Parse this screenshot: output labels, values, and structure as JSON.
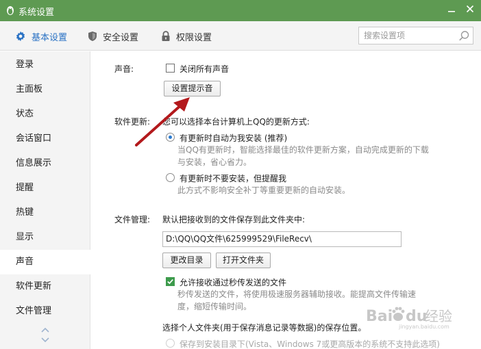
{
  "window": {
    "title": "系统设置"
  },
  "top_tabs": [
    {
      "label": "基本设置",
      "icon": "gear-icon"
    },
    {
      "label": "安全设置",
      "icon": "shield-icon"
    },
    {
      "label": "权限设置",
      "icon": "lock-icon"
    }
  ],
  "search": {
    "placeholder": "搜索设置项"
  },
  "sidebar": {
    "items": [
      {
        "label": "登录"
      },
      {
        "label": "主面板"
      },
      {
        "label": "状态"
      },
      {
        "label": "会话窗口"
      },
      {
        "label": "信息展示"
      },
      {
        "label": "提醒"
      },
      {
        "label": "热键"
      },
      {
        "label": "显示"
      },
      {
        "label": "声音"
      },
      {
        "label": "软件更新"
      },
      {
        "label": "文件管理"
      }
    ],
    "active": "声音"
  },
  "sound": {
    "label": "声音:",
    "mute_all": "关闭所有声音",
    "set_tone_button": "设置提示音"
  },
  "update": {
    "label": "软件更新:",
    "intro": "您可以选择本台计算机上QQ的更新方式:",
    "option_auto": "有更新时自动为我安装 (推荐)",
    "option_auto_desc_1": "当QQ有更新时，智能选择最佳的软件更新方案，自动完成更新的下载",
    "option_auto_desc_2": "与安装，省心省力。",
    "option_notify": "有更新时不要安装，但提醒我",
    "option_notify_desc": "此方式不影响安全补丁等重要更新的自动安装。"
  },
  "files": {
    "label": "文件管理:",
    "intro": "默认把接收到的文件保存到此文件夹中:",
    "path": "D:\\QQ\\QQ文件\\625999529\\FileRecv\\",
    "change_dir_button": "更改目录",
    "open_folder_button": "打开文件夹",
    "allow_flash": "允许接收通过秒传发送的文件",
    "allow_flash_desc_1": "秒传发送的文件，将使用极速服务器辅助接收。能提高文件传输速",
    "allow_flash_desc_2": "度，缩短传输时间。",
    "personal_folder": "选择个人文件夹(用于保存消息记录等数据)的保存位置。",
    "save_install_dir": "保存到安装目录下(Vista、Windows 7或更高版本的系统不支持此选项)"
  },
  "watermark": {
    "brand_latin_1": "Bai",
    "brand_latin_2": "du",
    "brand_cn": "经验",
    "site": "jingyan.baidu.com"
  },
  "colors": {
    "titlebar": "#5e9a52",
    "accent_blue": "#2a72c4",
    "check_green": "#3d9b4c",
    "arrow_red": "#b3191c"
  }
}
